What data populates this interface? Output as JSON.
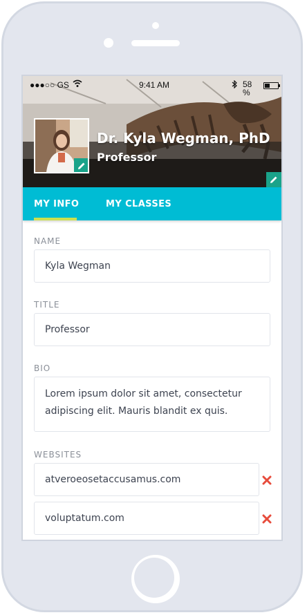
{
  "status_bar": {
    "signal": "●●●○○ GS",
    "time": "9:41 AM",
    "battery": "58 %"
  },
  "profile": {
    "name": "Dr. Kyla Wegman, PhD",
    "role": "Professor"
  },
  "tabs": [
    {
      "label": "MY INFO",
      "active": true
    },
    {
      "label": "MY CLASSES",
      "active": false
    }
  ],
  "form": {
    "name": {
      "label": "NAME",
      "value": "Kyla Wegman"
    },
    "title": {
      "label": "TITLE",
      "value": "Professor"
    },
    "bio": {
      "label": "BIO",
      "value": "Lorem ipsum dolor sit amet, consectetur adipiscing elit. Mauris blandit ex quis."
    },
    "websites": {
      "label": "WEBSITES",
      "items": [
        "atveroeosetaccusamus.com",
        "voluptatum.com"
      ]
    }
  },
  "colors": {
    "accent": "#00bcd4",
    "tab_indicator": "#cde04f",
    "edit_badge": "#1aa38a",
    "remove": "#e74c3c"
  },
  "icons": {
    "edit": "pencil-icon",
    "remove": "close-icon",
    "wifi": "wifi-icon",
    "bluetooth": "bluetooth-icon",
    "battery": "battery-icon"
  }
}
